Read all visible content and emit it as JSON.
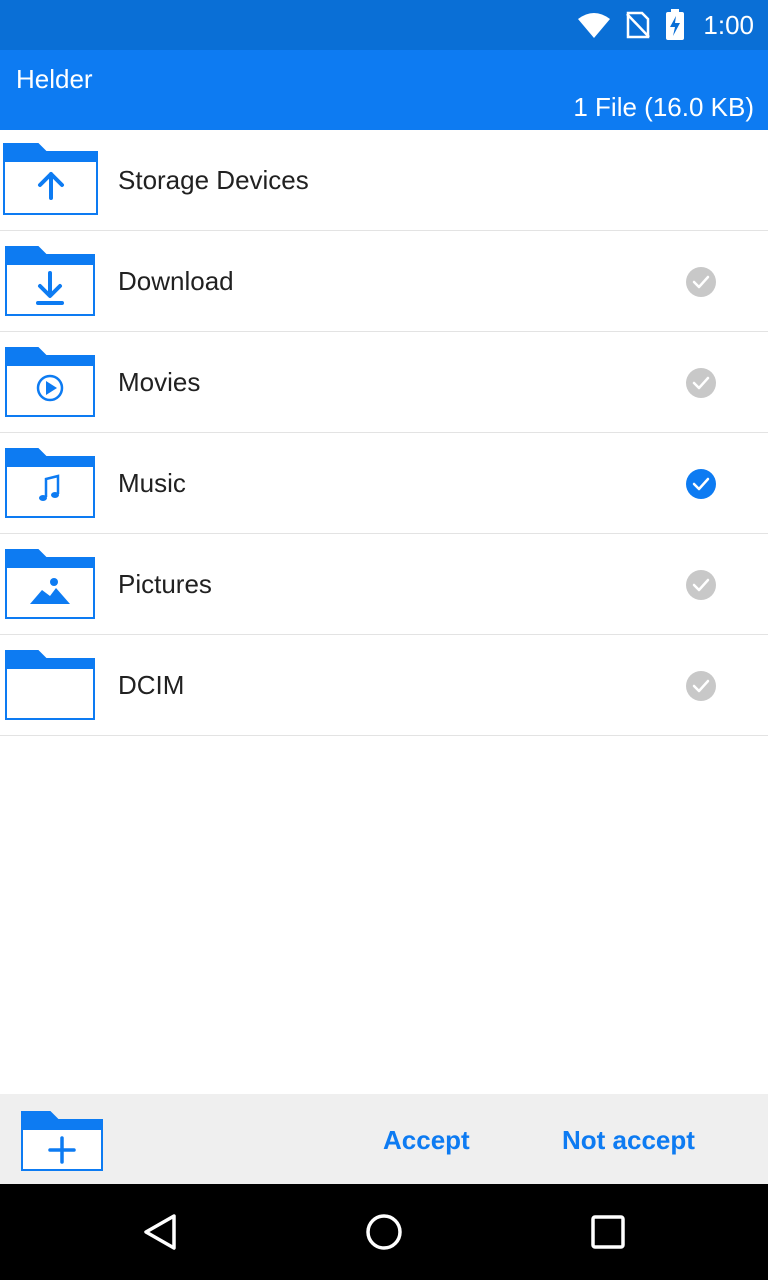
{
  "status_bar": {
    "time": "1:00",
    "icons": [
      "wifi-icon",
      "no-sim-icon",
      "battery-charging-icon"
    ]
  },
  "app_bar": {
    "title": "Helder",
    "file_summary": "1 File (16.0 KB)"
  },
  "folders": [
    {
      "label": "Storage Devices",
      "icon": "folder-up-icon",
      "selectable": false
    },
    {
      "label": "Download",
      "icon": "folder-download-icon",
      "checked": false
    },
    {
      "label": "Movies",
      "icon": "folder-movies-icon",
      "checked": false
    },
    {
      "label": "Music",
      "icon": "folder-music-icon",
      "checked": true
    },
    {
      "label": "Pictures",
      "icon": "folder-pictures-icon",
      "checked": false
    },
    {
      "label": "DCIM",
      "icon": "folder-icon",
      "checked": false
    }
  ],
  "bottom_bar": {
    "accept_label": "Accept",
    "not_accept_label": "Not accept",
    "new_folder_icon": "new-folder-icon"
  },
  "nav_bar": {
    "icons": [
      "back-icon",
      "home-icon",
      "recents-icon"
    ]
  },
  "colors": {
    "status_bar": "#0a6fd6",
    "app_bar": "#0d7bf2",
    "accent": "#0d7bf2",
    "unchecked": "#c8c8c8"
  }
}
